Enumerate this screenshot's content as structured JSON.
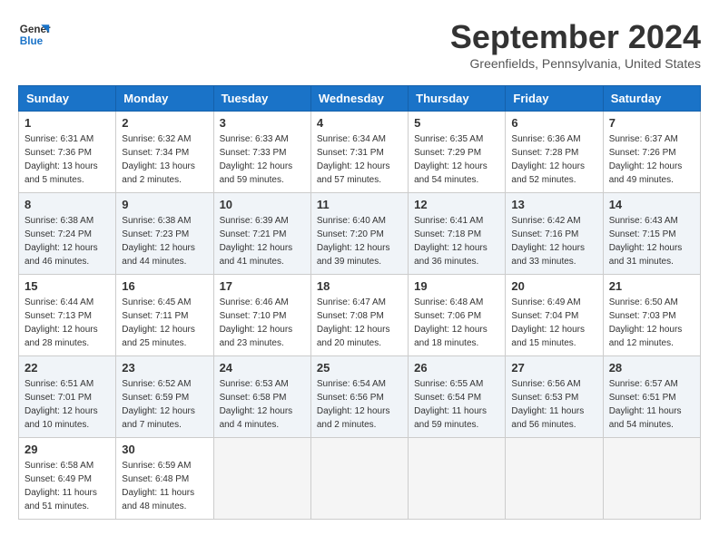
{
  "header": {
    "logo_line1": "General",
    "logo_line2": "Blue",
    "month_title": "September 2024",
    "location": "Greenfields, Pennsylvania, United States"
  },
  "weekdays": [
    "Sunday",
    "Monday",
    "Tuesday",
    "Wednesday",
    "Thursday",
    "Friday",
    "Saturday"
  ],
  "weeks": [
    [
      {
        "day": "1",
        "info": "Sunrise: 6:31 AM\nSunset: 7:36 PM\nDaylight: 13 hours\nand 5 minutes."
      },
      {
        "day": "2",
        "info": "Sunrise: 6:32 AM\nSunset: 7:34 PM\nDaylight: 13 hours\nand 2 minutes."
      },
      {
        "day": "3",
        "info": "Sunrise: 6:33 AM\nSunset: 7:33 PM\nDaylight: 12 hours\nand 59 minutes."
      },
      {
        "day": "4",
        "info": "Sunrise: 6:34 AM\nSunset: 7:31 PM\nDaylight: 12 hours\nand 57 minutes."
      },
      {
        "day": "5",
        "info": "Sunrise: 6:35 AM\nSunset: 7:29 PM\nDaylight: 12 hours\nand 54 minutes."
      },
      {
        "day": "6",
        "info": "Sunrise: 6:36 AM\nSunset: 7:28 PM\nDaylight: 12 hours\nand 52 minutes."
      },
      {
        "day": "7",
        "info": "Sunrise: 6:37 AM\nSunset: 7:26 PM\nDaylight: 12 hours\nand 49 minutes."
      }
    ],
    [
      {
        "day": "8",
        "info": "Sunrise: 6:38 AM\nSunset: 7:24 PM\nDaylight: 12 hours\nand 46 minutes."
      },
      {
        "day": "9",
        "info": "Sunrise: 6:38 AM\nSunset: 7:23 PM\nDaylight: 12 hours\nand 44 minutes."
      },
      {
        "day": "10",
        "info": "Sunrise: 6:39 AM\nSunset: 7:21 PM\nDaylight: 12 hours\nand 41 minutes."
      },
      {
        "day": "11",
        "info": "Sunrise: 6:40 AM\nSunset: 7:20 PM\nDaylight: 12 hours\nand 39 minutes."
      },
      {
        "day": "12",
        "info": "Sunrise: 6:41 AM\nSunset: 7:18 PM\nDaylight: 12 hours\nand 36 minutes."
      },
      {
        "day": "13",
        "info": "Sunrise: 6:42 AM\nSunset: 7:16 PM\nDaylight: 12 hours\nand 33 minutes."
      },
      {
        "day": "14",
        "info": "Sunrise: 6:43 AM\nSunset: 7:15 PM\nDaylight: 12 hours\nand 31 minutes."
      }
    ],
    [
      {
        "day": "15",
        "info": "Sunrise: 6:44 AM\nSunset: 7:13 PM\nDaylight: 12 hours\nand 28 minutes."
      },
      {
        "day": "16",
        "info": "Sunrise: 6:45 AM\nSunset: 7:11 PM\nDaylight: 12 hours\nand 25 minutes."
      },
      {
        "day": "17",
        "info": "Sunrise: 6:46 AM\nSunset: 7:10 PM\nDaylight: 12 hours\nand 23 minutes."
      },
      {
        "day": "18",
        "info": "Sunrise: 6:47 AM\nSunset: 7:08 PM\nDaylight: 12 hours\nand 20 minutes."
      },
      {
        "day": "19",
        "info": "Sunrise: 6:48 AM\nSunset: 7:06 PM\nDaylight: 12 hours\nand 18 minutes."
      },
      {
        "day": "20",
        "info": "Sunrise: 6:49 AM\nSunset: 7:04 PM\nDaylight: 12 hours\nand 15 minutes."
      },
      {
        "day": "21",
        "info": "Sunrise: 6:50 AM\nSunset: 7:03 PM\nDaylight: 12 hours\nand 12 minutes."
      }
    ],
    [
      {
        "day": "22",
        "info": "Sunrise: 6:51 AM\nSunset: 7:01 PM\nDaylight: 12 hours\nand 10 minutes."
      },
      {
        "day": "23",
        "info": "Sunrise: 6:52 AM\nSunset: 6:59 PM\nDaylight: 12 hours\nand 7 minutes."
      },
      {
        "day": "24",
        "info": "Sunrise: 6:53 AM\nSunset: 6:58 PM\nDaylight: 12 hours\nand 4 minutes."
      },
      {
        "day": "25",
        "info": "Sunrise: 6:54 AM\nSunset: 6:56 PM\nDaylight: 12 hours\nand 2 minutes."
      },
      {
        "day": "26",
        "info": "Sunrise: 6:55 AM\nSunset: 6:54 PM\nDaylight: 11 hours\nand 59 minutes."
      },
      {
        "day": "27",
        "info": "Sunrise: 6:56 AM\nSunset: 6:53 PM\nDaylight: 11 hours\nand 56 minutes."
      },
      {
        "day": "28",
        "info": "Sunrise: 6:57 AM\nSunset: 6:51 PM\nDaylight: 11 hours\nand 54 minutes."
      }
    ],
    [
      {
        "day": "29",
        "info": "Sunrise: 6:58 AM\nSunset: 6:49 PM\nDaylight: 11 hours\nand 51 minutes."
      },
      {
        "day": "30",
        "info": "Sunrise: 6:59 AM\nSunset: 6:48 PM\nDaylight: 11 hours\nand 48 minutes."
      },
      {
        "day": "",
        "info": ""
      },
      {
        "day": "",
        "info": ""
      },
      {
        "day": "",
        "info": ""
      },
      {
        "day": "",
        "info": ""
      },
      {
        "day": "",
        "info": ""
      }
    ]
  ]
}
